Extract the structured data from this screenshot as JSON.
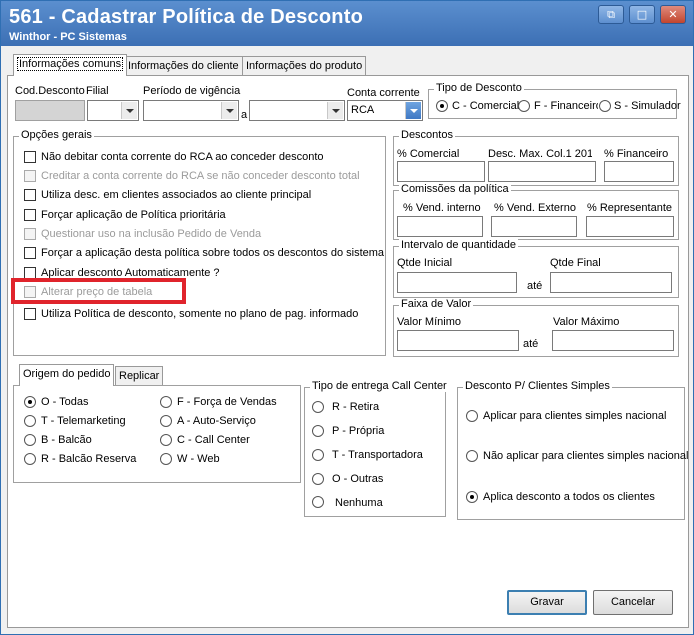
{
  "window": {
    "title": "561 - Cadastrar Política de Desconto",
    "subtitle": "Winthor - PC Sistemas"
  },
  "main_tabs": [
    "Informações comuns",
    "Informações do cliente",
    "Informações do produto"
  ],
  "header_fields": {
    "cod_desconto_label": "Cod.Desconto",
    "filial_label": "Filial",
    "periodo_label": "Período de vigência",
    "a_label": "a",
    "conta_corrente_label": "Conta corrente",
    "conta_corrente_value": "RCA"
  },
  "tipo_desconto": {
    "title": "Tipo de Desconto",
    "options": [
      "C - Comercial",
      "F - Financeiro",
      "S - Simulador"
    ],
    "selected": "C - Comercial"
  },
  "opcoes_gerais": {
    "title": "Opções gerais",
    "items": [
      "Não debitar conta corrente do RCA ao conceder desconto",
      "Creditar a conta corrente do RCA se não conceder desconto total",
      "Utiliza desc. em clientes associados ao cliente principal",
      "Forçar aplicação de Política prioritária",
      "Questionar uso na inclusão Pedido de Venda",
      "Forçar a aplicação desta política sobre todos os descontos do sistema",
      "Aplicar desconto Automaticamente ?",
      "Alterar preço de tabela",
      "Utiliza Política de desconto, somente no plano de pag. informado"
    ]
  },
  "descontos": {
    "title": "Descontos",
    "labels": [
      "% Comercial",
      "Desc. Max. Col.1 201",
      "% Financeiro"
    ]
  },
  "comissoes": {
    "title": "Comissões da política",
    "labels": [
      "% Vend. interno",
      "% Vend. Externo",
      "% Representante"
    ]
  },
  "intervalo_qtd": {
    "title": "Intervalo de quantidade",
    "inicial_label": "Qtde Inicial",
    "final_label": "Qtde Final",
    "ate_label": "até"
  },
  "faixa_valor": {
    "title": "Faixa de Valor",
    "minimo_label": "Valor Mínimo",
    "maximo_label": "Valor Máximo",
    "ate_label": "até"
  },
  "lower_tabs": [
    "Origem do pedido",
    "Replicar"
  ],
  "origem": {
    "options_left": [
      "O - Todas",
      "T - Telemarketing",
      "B - Balcão",
      "R - Balcão Reserva"
    ],
    "options_right": [
      "F - Força de Vendas",
      "A - Auto-Serviço",
      "C - Call Center",
      "W - Web"
    ],
    "selected": "O - Todas"
  },
  "entrega": {
    "title": "Tipo de entrega Call Center",
    "options": [
      "R - Retira",
      "P - Própria",
      "T - Transportadora",
      "O - Outras",
      "Nenhuma"
    ]
  },
  "simples": {
    "title": "Desconto P/ Clientes Simples",
    "options": [
      "Aplicar para clientes simples nacional",
      "Não aplicar para clientes simples nacional",
      "Aplica desconto a todos os clientes"
    ],
    "selected": "Aplica desconto a todos os clientes"
  },
  "buttons": {
    "gravar": "Gravar",
    "cancelar": "Cancelar"
  },
  "colors": {
    "titlebar": "#4a80c4",
    "highlight": "#e0242c"
  }
}
